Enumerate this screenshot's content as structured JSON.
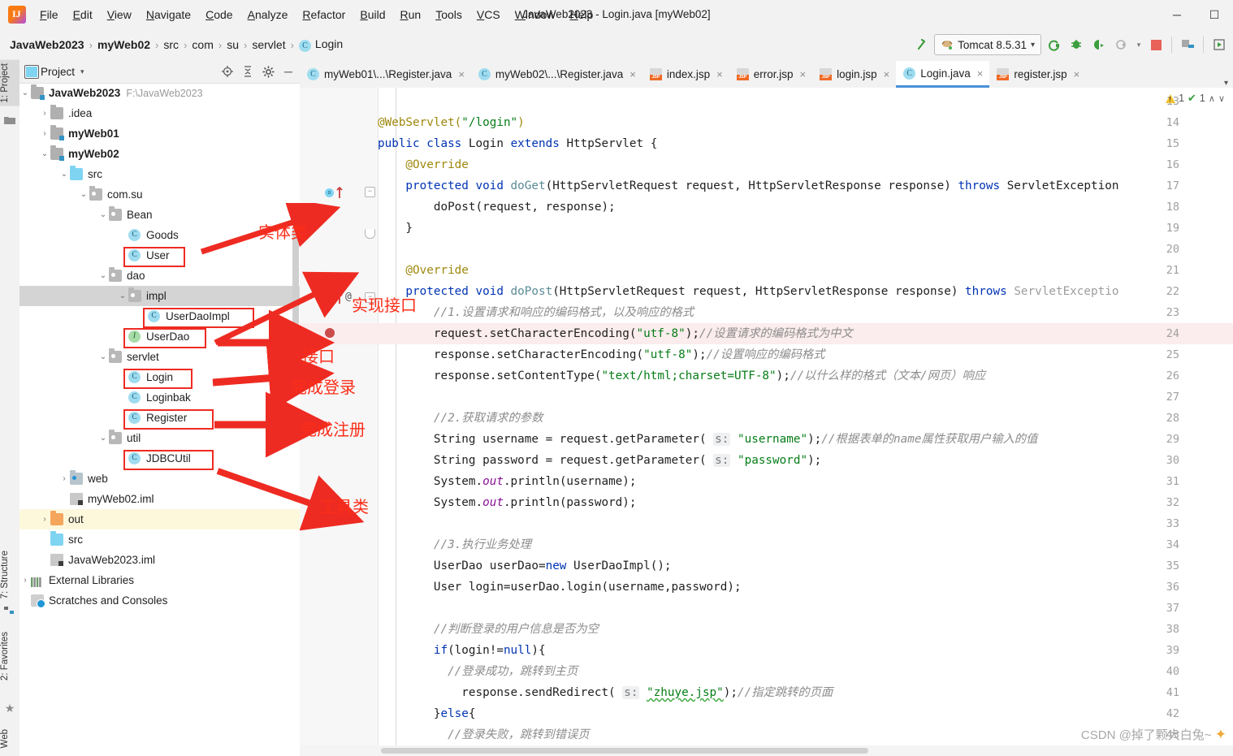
{
  "window": {
    "title": "JavaWeb2023 - Login.java [myWeb02]",
    "minimize": "─",
    "maximize": "☐"
  },
  "menu": {
    "items": [
      {
        "label": "File"
      },
      {
        "label": "Edit"
      },
      {
        "label": "View"
      },
      {
        "label": "Navigate"
      },
      {
        "label": "Code"
      },
      {
        "label": "Analyze"
      },
      {
        "label": "Refactor"
      },
      {
        "label": "Build"
      },
      {
        "label": "Run"
      },
      {
        "label": "Tools"
      },
      {
        "label": "VCS"
      },
      {
        "label": "Window"
      },
      {
        "label": "Help"
      }
    ]
  },
  "breadcrumb": {
    "items": [
      "JavaWeb2023",
      "myWeb02",
      "src",
      "com",
      "su",
      "servlet",
      "Login"
    ],
    "separator": "›"
  },
  "runbar": {
    "config_name": "Tomcat 8.5.31",
    "dropdown_caret": "▾",
    "buttons": [
      {
        "name": "hammer-build-icon",
        "glyph": "↖"
      },
      {
        "name": "run-icon",
        "glyph": "⟳"
      },
      {
        "name": "debug-icon",
        "glyph": "☣"
      },
      {
        "name": "run-coverage-icon",
        "glyph": "➤"
      },
      {
        "name": "profiler-icon",
        "glyph": "◔"
      },
      {
        "name": "stop-icon",
        "glyph": "■"
      },
      {
        "name": "project-structure-icon",
        "glyph": "▤"
      },
      {
        "name": "update-app-icon",
        "glyph": "▷"
      }
    ]
  },
  "left_strip": {
    "tabs": [
      {
        "label": "1: Project",
        "active": true
      },
      {
        "label": "7: Structure",
        "active": false
      },
      {
        "label": "2: Favorites",
        "active": false
      },
      {
        "label": "Web",
        "active": false
      }
    ]
  },
  "project_panel": {
    "title": "Project",
    "chevron": "▾",
    "header_icons": [
      {
        "name": "locate-target-icon",
        "glyph": "⊕"
      },
      {
        "name": "collapse-all-icon",
        "glyph": "⤓"
      },
      {
        "name": "settings-gear-icon",
        "glyph": "⚙"
      },
      {
        "name": "hide-panel-icon",
        "glyph": "─"
      }
    ],
    "tree": [
      {
        "indent": 0,
        "arrow": "⌄",
        "icon": "module-folder",
        "label": "JavaWeb2023",
        "bold": true,
        "path": "F:\\JavaWeb2023"
      },
      {
        "indent": 1,
        "arrow": "›",
        "icon": "grey-folder",
        "label": ".idea",
        "bold": false
      },
      {
        "indent": 1,
        "arrow": "›",
        "icon": "module-folder",
        "label": "myWeb01",
        "bold": true
      },
      {
        "indent": 1,
        "arrow": "⌄",
        "icon": "module-folder",
        "label": "myWeb02",
        "bold": true
      },
      {
        "indent": 2,
        "arrow": "⌄",
        "icon": "source-folder",
        "label": "src",
        "bold": false
      },
      {
        "indent": 3,
        "arrow": "⌄",
        "icon": "package",
        "label": "com.su",
        "bold": false
      },
      {
        "indent": 4,
        "arrow": "⌄",
        "icon": "package",
        "label": "Bean",
        "bold": false
      },
      {
        "indent": 5,
        "arrow": "",
        "icon": "class",
        "label": "Goods",
        "bold": false
      },
      {
        "indent": 5,
        "arrow": "",
        "icon": "class",
        "label": "User",
        "bold": false,
        "boxed": true
      },
      {
        "indent": 4,
        "arrow": "⌄",
        "icon": "package",
        "label": "dao",
        "bold": false
      },
      {
        "indent": 5,
        "arrow": "⌄",
        "icon": "package",
        "label": "impl",
        "bold": false,
        "selected": true
      },
      {
        "indent": 6,
        "arrow": "",
        "icon": "class",
        "label": "UserDaoImpl",
        "bold": false,
        "boxed": true
      },
      {
        "indent": 5,
        "arrow": "",
        "icon": "interface",
        "label": "UserDao",
        "bold": false,
        "boxed": true
      },
      {
        "indent": 4,
        "arrow": "⌄",
        "icon": "package",
        "label": "servlet",
        "bold": false
      },
      {
        "indent": 5,
        "arrow": "",
        "icon": "class",
        "label": "Login",
        "bold": false,
        "boxed": true
      },
      {
        "indent": 5,
        "arrow": "",
        "icon": "class",
        "label": "Loginbak",
        "bold": false
      },
      {
        "indent": 5,
        "arrow": "",
        "icon": "class",
        "label": "Register",
        "bold": false,
        "boxed": true
      },
      {
        "indent": 4,
        "arrow": "⌄",
        "icon": "package",
        "label": "util",
        "bold": false
      },
      {
        "indent": 5,
        "arrow": "",
        "icon": "class",
        "label": "JDBCUtil",
        "bold": false,
        "boxed": true
      },
      {
        "indent": 2,
        "arrow": "›",
        "icon": "web-folder",
        "label": "web",
        "bold": false
      },
      {
        "indent": 2,
        "arrow": "",
        "icon": "iml",
        "label": "myWeb02.iml",
        "bold": false
      },
      {
        "indent": 1,
        "arrow": "›",
        "icon": "out-folder",
        "label": "out",
        "bold": false,
        "highlight": true
      },
      {
        "indent": 1,
        "arrow": "",
        "icon": "source-folder",
        "label": "src",
        "bold": false
      },
      {
        "indent": 1,
        "arrow": "",
        "icon": "iml",
        "label": "JavaWeb2023.iml",
        "bold": false
      },
      {
        "indent": 0,
        "arrow": "›",
        "icon": "ext-libs",
        "label": "External Libraries",
        "bold": false
      },
      {
        "indent": 0,
        "arrow": "",
        "icon": "scratches",
        "label": "Scratches and Consoles",
        "bold": false
      }
    ]
  },
  "annotations": {
    "color": "#fb2d18",
    "labels": [
      {
        "text": "实体类",
        "meaning": "entity-class"
      },
      {
        "text": "实现接口",
        "meaning": "implements-interface"
      },
      {
        "text": "接口",
        "meaning": "interface"
      },
      {
        "text": "完成登录",
        "meaning": "complete-login"
      },
      {
        "text": "完成注册",
        "meaning": "complete-register"
      },
      {
        "text": "工具类",
        "meaning": "utility-class"
      }
    ]
  },
  "editor_tabs": {
    "items": [
      {
        "label": "myWeb01\\...\\Register.java",
        "icon": "java-class",
        "active": false,
        "close": "×"
      },
      {
        "label": "myWeb02\\...\\Register.java",
        "icon": "java-class",
        "active": false,
        "close": "×"
      },
      {
        "label": "index.jsp",
        "icon": "jsp",
        "active": false,
        "close": "×"
      },
      {
        "label": "error.jsp",
        "icon": "jsp",
        "active": false,
        "close": "×"
      },
      {
        "label": "login.jsp",
        "icon": "jsp",
        "active": false,
        "close": "×"
      },
      {
        "label": "Login.java",
        "icon": "java-class",
        "active": true,
        "close": "×"
      },
      {
        "label": "register.jsp",
        "icon": "jsp",
        "active": false,
        "close": "×"
      }
    ],
    "overflow_chevron": "▾"
  },
  "inspections": {
    "warning_count": "1",
    "check_count": "1",
    "up_caret": "∧",
    "down_caret": "∨"
  },
  "editor": {
    "first_line": 13,
    "line_numbers": [
      13,
      14,
      15,
      16,
      17,
      18,
      19,
      20,
      21,
      22,
      23,
      24,
      25,
      26,
      27,
      28,
      29,
      30,
      31,
      32,
      33,
      34,
      35,
      36,
      37,
      38,
      39,
      40,
      41,
      42,
      43
    ],
    "lines": [
      {
        "n": 13,
        "segments": []
      },
      {
        "n": 14,
        "segments": [
          {
            "t": "@WebServlet(",
            "c": "ann"
          },
          {
            "t": "\"/login\"",
            "c": "str"
          },
          {
            "t": ")",
            "c": "ann"
          }
        ]
      },
      {
        "n": 15,
        "segments": [
          {
            "t": "public class ",
            "c": "k"
          },
          {
            "t": "Login ",
            "c": ""
          },
          {
            "t": "extends ",
            "c": "k"
          },
          {
            "t": "HttpServlet {",
            "c": ""
          }
        ]
      },
      {
        "n": 16,
        "segments": [
          {
            "t": "    @Override",
            "c": "ann"
          }
        ]
      },
      {
        "n": 17,
        "segments": [
          {
            "t": "    protected void ",
            "c": "k"
          },
          {
            "t": "doGet",
            "c": "mth"
          },
          {
            "t": "(HttpServletRequest request, HttpServletResponse response) ",
            "c": ""
          },
          {
            "t": "throws ",
            "c": "k"
          },
          {
            "t": "ServletException",
            "c": ""
          }
        ]
      },
      {
        "n": 18,
        "segments": [
          {
            "t": "        doPost(request, response);",
            "c": ""
          }
        ]
      },
      {
        "n": 19,
        "segments": [
          {
            "t": "    }",
            "c": ""
          }
        ]
      },
      {
        "n": 20,
        "segments": []
      },
      {
        "n": 21,
        "segments": [
          {
            "t": "    @Override",
            "c": "ann"
          }
        ]
      },
      {
        "n": 22,
        "segments": [
          {
            "t": "    protected void ",
            "c": "k"
          },
          {
            "t": "doPost",
            "c": "mth"
          },
          {
            "t": "(HttpServletRequest request, HttpServletResponse response) ",
            "c": ""
          },
          {
            "t": "throws ",
            "c": "k"
          },
          {
            "t": "ServletExceptio",
            "c": "grey"
          }
        ]
      },
      {
        "n": 23,
        "segments": [
          {
            "t": "        //1.设置请求和响应的编码格式，以及响应的格式",
            "c": "cmt"
          }
        ]
      },
      {
        "n": 24,
        "segments": [
          {
            "t": "        request.setCharacterEncoding(",
            "c": ""
          },
          {
            "t": "\"utf-8\"",
            "c": "str"
          },
          {
            "t": ");",
            "c": ""
          },
          {
            "t": "//设置请求的编码格式为中文",
            "c": "cmt"
          }
        ],
        "highlight": true
      },
      {
        "n": 25,
        "segments": [
          {
            "t": "        response.setCharacterEncoding(",
            "c": ""
          },
          {
            "t": "\"utf-8\"",
            "c": "str"
          },
          {
            "t": ");",
            "c": ""
          },
          {
            "t": "//设置响应的编码格式",
            "c": "cmt"
          }
        ]
      },
      {
        "n": 26,
        "segments": [
          {
            "t": "        response.setContentType(",
            "c": ""
          },
          {
            "t": "\"text/html;charset=UTF-8\"",
            "c": "str"
          },
          {
            "t": ");",
            "c": ""
          },
          {
            "t": "//以什么样的格式（文本/网页）响应",
            "c": "cmt"
          }
        ]
      },
      {
        "n": 27,
        "segments": []
      },
      {
        "n": 28,
        "segments": [
          {
            "t": "        //2.获取请求的参数",
            "c": "cmt"
          }
        ]
      },
      {
        "n": 29,
        "segments": [
          {
            "t": "        String username = request.getParameter( ",
            "c": ""
          },
          {
            "t": "s:",
            "c": "hint"
          },
          {
            "t": " ",
            "c": ""
          },
          {
            "t": "\"username\"",
            "c": "str"
          },
          {
            "t": ");",
            "c": ""
          },
          {
            "t": "//根据表单的name属性获取用户输入的值",
            "c": "cmt"
          }
        ]
      },
      {
        "n": 30,
        "segments": [
          {
            "t": "        String password = request.getParameter( ",
            "c": ""
          },
          {
            "t": "s:",
            "c": "hint"
          },
          {
            "t": " ",
            "c": ""
          },
          {
            "t": "\"password\"",
            "c": "str"
          },
          {
            "t": ");",
            "c": ""
          }
        ]
      },
      {
        "n": 31,
        "segments": [
          {
            "t": "        System.",
            "c": ""
          },
          {
            "t": "out",
            "c": "fld"
          },
          {
            "t": ".println(username);",
            "c": ""
          }
        ]
      },
      {
        "n": 32,
        "segments": [
          {
            "t": "        System.",
            "c": ""
          },
          {
            "t": "out",
            "c": "fld"
          },
          {
            "t": ".println(password);",
            "c": ""
          }
        ]
      },
      {
        "n": 33,
        "segments": []
      },
      {
        "n": 34,
        "segments": [
          {
            "t": "        //3.执行业务处理",
            "c": "cmt"
          }
        ]
      },
      {
        "n": 35,
        "segments": [
          {
            "t": "        UserDao userDao=",
            "c": ""
          },
          {
            "t": "new ",
            "c": "k"
          },
          {
            "t": "UserDaoImpl();",
            "c": ""
          }
        ]
      },
      {
        "n": 36,
        "segments": [
          {
            "t": "        User login=userDao.login(username,password);",
            "c": ""
          }
        ]
      },
      {
        "n": 37,
        "segments": []
      },
      {
        "n": 38,
        "segments": [
          {
            "t": "        //判断登录的用户信息是否为空",
            "c": "cmt"
          }
        ]
      },
      {
        "n": 39,
        "segments": [
          {
            "t": "        if",
            "c": "k"
          },
          {
            "t": "(login!=",
            "c": ""
          },
          {
            "t": "null",
            "c": "k"
          },
          {
            "t": "){",
            "c": ""
          }
        ]
      },
      {
        "n": 40,
        "segments": [
          {
            "t": "          //登录成功，跳转到主页",
            "c": "cmt"
          }
        ]
      },
      {
        "n": 41,
        "segments": [
          {
            "t": "            response.sendRedirect( ",
            "c": ""
          },
          {
            "t": "s:",
            "c": "hint"
          },
          {
            "t": " ",
            "c": ""
          },
          {
            "t": "\"zhuye.jsp\"",
            "c": "strwave"
          },
          {
            "t": ");",
            "c": ""
          },
          {
            "t": "//指定跳转的页面",
            "c": "cmt"
          }
        ]
      },
      {
        "n": 42,
        "segments": [
          {
            "t": "        }",
            "c": ""
          },
          {
            "t": "else",
            "c": "k"
          },
          {
            "t": "{",
            "c": ""
          }
        ]
      },
      {
        "n": 43,
        "segments": [
          {
            "t": "          //登录失败，跳转到错误页",
            "c": "cmt"
          }
        ]
      }
    ]
  },
  "watermark": {
    "text": "CSDN @掉了颗大白兔~"
  }
}
